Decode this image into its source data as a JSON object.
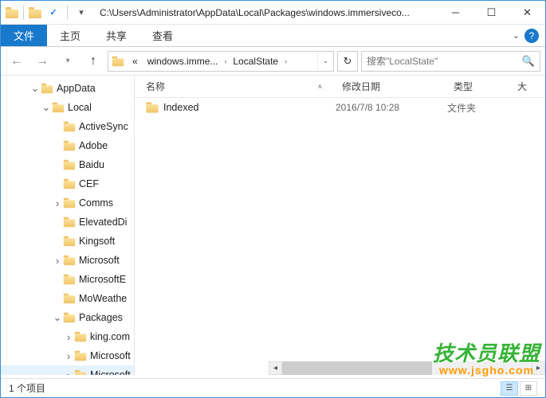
{
  "title": "C:\\Users\\Administrator\\AppData\\Local\\Packages\\windows.immersiveco...",
  "ribbon": {
    "file": "文件",
    "home": "主页",
    "share": "共享",
    "view": "查看"
  },
  "breadcrumbs": [
    {
      "label": "«"
    },
    {
      "label": "windows.imme..."
    },
    {
      "label": "LocalState"
    }
  ],
  "search_placeholder": "搜索\"LocalState\"",
  "tree": [
    {
      "indent": 36,
      "toggle": "open",
      "label": "AppData"
    },
    {
      "indent": 50,
      "toggle": "open",
      "label": "Local"
    },
    {
      "indent": 64,
      "toggle": "none",
      "label": "ActiveSync"
    },
    {
      "indent": 64,
      "toggle": "none",
      "label": "Adobe"
    },
    {
      "indent": 64,
      "toggle": "none",
      "label": "Baidu"
    },
    {
      "indent": 64,
      "toggle": "none",
      "label": "CEF"
    },
    {
      "indent": 64,
      "toggle": "closed",
      "label": "Comms"
    },
    {
      "indent": 64,
      "toggle": "none",
      "label": "ElevatedDi"
    },
    {
      "indent": 64,
      "toggle": "none",
      "label": "Kingsoft"
    },
    {
      "indent": 64,
      "toggle": "closed",
      "label": "Microsoft"
    },
    {
      "indent": 64,
      "toggle": "none",
      "label": "MicrosoftE"
    },
    {
      "indent": 64,
      "toggle": "none",
      "label": "MoWeathe"
    },
    {
      "indent": 64,
      "toggle": "open",
      "label": "Packages"
    },
    {
      "indent": 78,
      "toggle": "closed",
      "label": "king.com"
    },
    {
      "indent": 78,
      "toggle": "closed",
      "label": "Microsoft"
    },
    {
      "indent": 78,
      "toggle": "closed",
      "label": "Microsoft",
      "hover": true
    }
  ],
  "columns": {
    "name": "名称",
    "date": "修改日期",
    "type": "类型",
    "size": "大"
  },
  "rows": [
    {
      "name": "Indexed",
      "date": "2016/7/8 10:28",
      "type": "文件夹"
    }
  ],
  "status": "1 个项目",
  "watermark": {
    "line1": "技术员联盟",
    "line2": "www.jsgho.com"
  }
}
